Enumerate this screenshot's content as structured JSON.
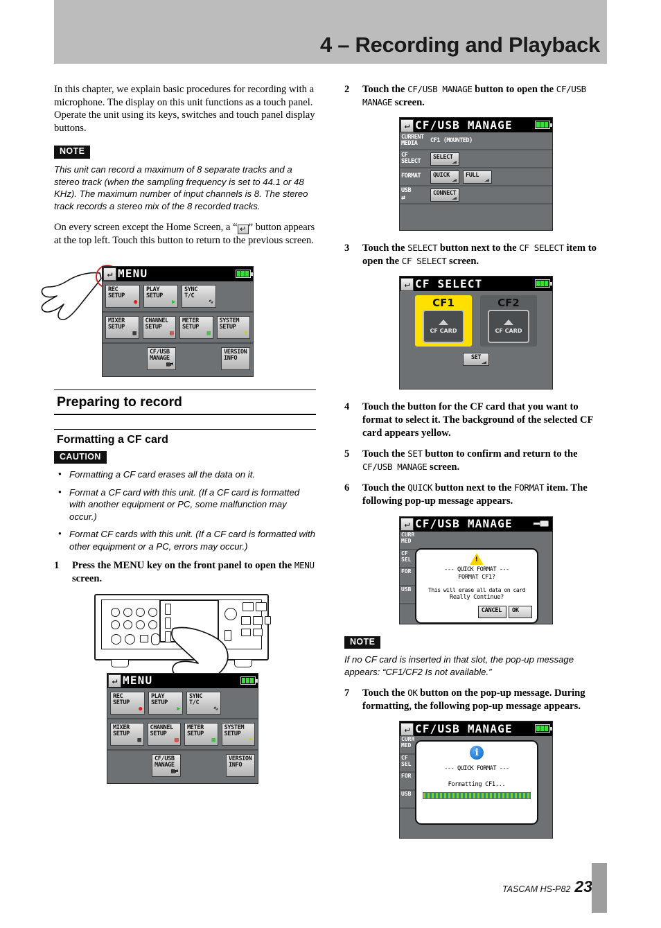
{
  "header": {
    "chapter_title": "4 – Recording and Playback"
  },
  "left": {
    "intro": "In this chapter, we explain basic procedures for recording with a microphone. The display on this unit functions as a touch panel. Operate the unit using its keys, switches and touch panel display buttons.",
    "note_badge": "NOTE",
    "note_text": "This unit can record a maximum of 8 separate tracks and a stereo track (when the sampling frequency is set to 44.1 or 48 KHz). The maximum number of input channels is 8. The stereo track records a stereo mix of the 8 recorded tracks.",
    "back_para_1": "On every screen except the Home Screen, a “",
    "back_para_2": "” button appears at the top left. Touch this button to return to the previous screen.",
    "section_heading": "Preparing to record",
    "sub_heading": "Formatting a CF card",
    "caution_badge": "CAUTION",
    "caution_items": [
      "Formatting a CF card erases all the data on it.",
      "Format a CF card with this unit. (If a CF card is formatted with another equipment or PC, some malfunction may occur.)",
      "Format CF cards with this unit. (If a CF card is formatted with other equipment or a PC, errors may occur.)"
    ],
    "step1": {
      "num": "1",
      "part1": "Press the MENU key on the front panel to open the ",
      "mono": "MENU",
      "part2": " screen."
    }
  },
  "menu_screen": {
    "title": "MENU",
    "back_icon": "back-arrow-icon",
    "battery_icon": "battery-icon",
    "rows": [
      [
        {
          "label": "REC\nSETUP",
          "icon": "record-dot-icon"
        },
        {
          "label": "PLAY\nSETUP",
          "icon": "play-triangle-icon"
        },
        {
          "label": "SYNC\nT/C",
          "icon": "waveform-icon"
        }
      ],
      [
        {
          "label": "MIXER\nSETUP",
          "icon": "mixer-grid-icon"
        },
        {
          "label": "CHANNEL\nSETUP",
          "icon": "channel-strip-icon"
        },
        {
          "label": "METER\nSETUP",
          "icon": "meter-bars-icon"
        },
        {
          "label": "SYSTEM\nSETUP",
          "icon": "wrench-icon"
        }
      ],
      [
        {
          "label": "CF/USB\nMANAGE",
          "icon": "cf-usb-icon"
        },
        {
          "label": "VERSION\nINFO",
          "icon": ""
        }
      ]
    ]
  },
  "right": {
    "step2": {
      "num": "2",
      "p1": "Touch the ",
      "m1": "CF/USB MANAGE",
      "p2": " button to open the ",
      "m2": "CF/USB MANAGE",
      "p3": " screen."
    },
    "step3": {
      "num": "3",
      "p1": "Touch the ",
      "m1": "SELECT",
      "p2": " button next to the ",
      "m2": "CF SELECT",
      "p3": " item to open the ",
      "m3": "CF SELECT",
      "p4": " screen."
    },
    "step4": {
      "num": "4",
      "text": "Touch the button for the CF card that you want to format to select it. The background of the selected CF card appears yellow."
    },
    "step5": {
      "num": "5",
      "p1": "Touch the ",
      "m1": "SET",
      "p2": " button to confirm and return to the ",
      "m2": "CF/USB MANAGE",
      "p3": " screen."
    },
    "step6": {
      "num": "6",
      "p1": "Touch the ",
      "m1": "QUICK",
      "p2": " button next to the ",
      "m2": "FORMAT",
      "p3": " item. The following pop-up message appears."
    },
    "note_badge": "NOTE",
    "note_text": "If no CF card is inserted in that slot, the  pop-up message appears: “CF1/CF2 Is not available.”",
    "step7": {
      "num": "7",
      "p1": "Touch the ",
      "m1": "OK",
      "p2": " button on the pop-up message. During formatting, the following pop-up message appears."
    }
  },
  "cfusb_screen": {
    "title": "CF/USB MANAGE",
    "rows": [
      {
        "label": "CURRENT\nMEDIA",
        "value": "CF1 (MOUNTED)",
        "buttons": []
      },
      {
        "label": "CF\nSELECT",
        "value": "",
        "buttons": [
          "SELECT"
        ]
      },
      {
        "label": "FORMAT",
        "value": "",
        "buttons": [
          "QUICK",
          "FULL"
        ]
      },
      {
        "label": "USB",
        "value": "",
        "buttons": [
          "CONNECT"
        ]
      }
    ]
  },
  "cfselect_screen": {
    "title": "CF SELECT",
    "cards": [
      {
        "name": "CF1",
        "caption": "CF CARD",
        "selected": true
      },
      {
        "name": "CF2",
        "caption": "CF CARD",
        "selected": false
      }
    ],
    "set_button": "SET"
  },
  "format_confirm_screen": {
    "title": "CF/USB MANAGE",
    "power_icon": "power-plug-icon",
    "warning_icon": "warning-triangle-icon",
    "line1": "--- QUICK FORMAT ---",
    "line2": "FORMAT CF1?",
    "line3": "This will erase all data on card",
    "line4": "Really Continue?",
    "cancel_button": "CANCEL",
    "ok_button": "OK",
    "side_labels": [
      "CURR\nMED",
      "CF\nSEL",
      "FOR",
      "USB"
    ]
  },
  "formatting_screen": {
    "title": "CF/USB MANAGE",
    "info_icon": "info-circle-icon",
    "line1": "--- QUICK FORMAT ---",
    "line2": "Formatting CF1...",
    "side_labels": [
      "CURR\nMED",
      "CF\nSEL",
      "FOR",
      "USB"
    ]
  },
  "footer": {
    "brand": "TASCAM  HS-P82",
    "page": "23"
  }
}
